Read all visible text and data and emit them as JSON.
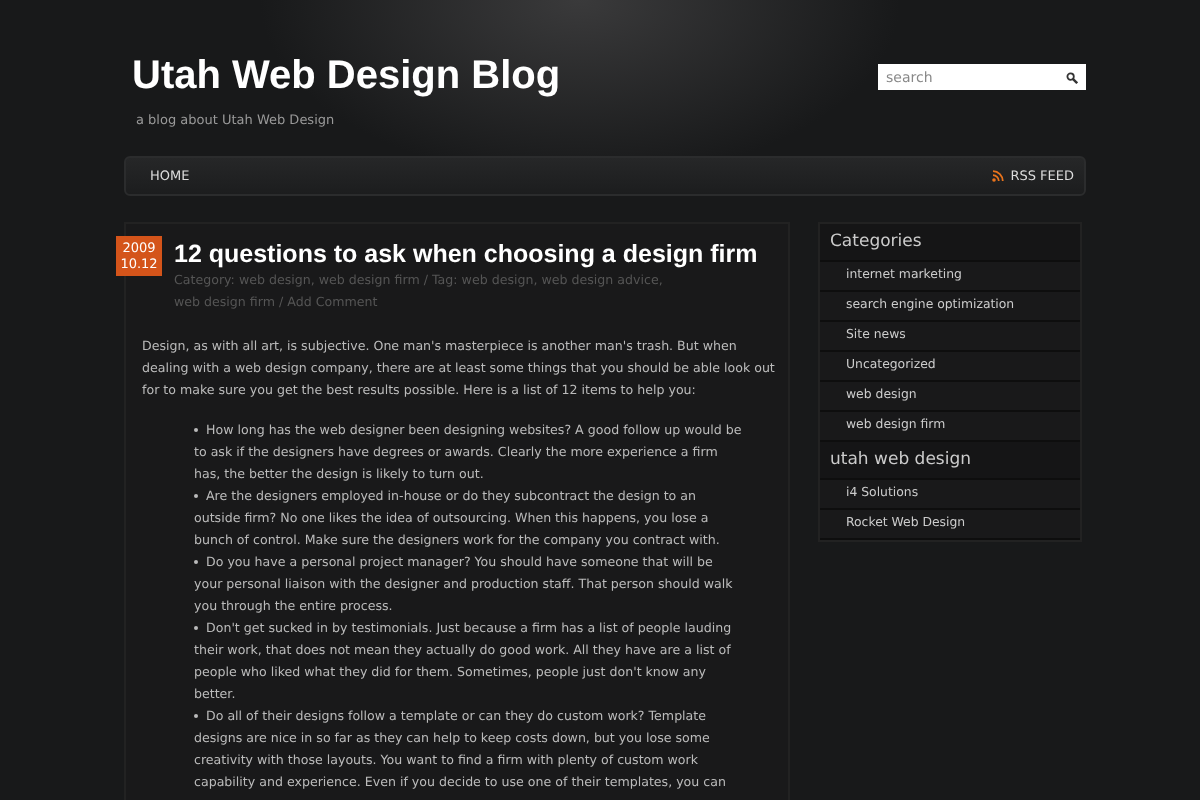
{
  "site": {
    "title": "Utah Web Design Blog",
    "tagline": "a blog about Utah Web Design"
  },
  "search": {
    "placeholder": "search"
  },
  "nav": {
    "items": [
      {
        "label": "HOME"
      }
    ],
    "feed": "RSS FEED"
  },
  "post": {
    "date_year": "2009",
    "date_day": "10.12",
    "title": "12 questions to ask when choosing a design firm",
    "meta": [
      {
        "kind": "text",
        "text": "Category: "
      },
      {
        "kind": "link",
        "text": "web design"
      },
      {
        "kind": "text",
        "text": ", "
      },
      {
        "kind": "link",
        "text": "web design firm"
      },
      {
        "kind": "text",
        "text": " / Tag: "
      },
      {
        "kind": "link",
        "text": "web design"
      },
      {
        "kind": "text",
        "text": ", "
      },
      {
        "kind": "link",
        "text": "web design advice"
      },
      {
        "kind": "text",
        "text": ", "
      },
      {
        "kind": "link",
        "text": "web design firm"
      },
      {
        "kind": "text",
        "text": " / "
      },
      {
        "kind": "link",
        "text": "Add Comment"
      }
    ],
    "intro": "Design, as with all art, is subjective. One man's masterpiece is another man's trash. But when dealing with a web design company, there are at least some things that you should be able look out for to make sure you get the best results possible. Here is a list of 12 items to help you:",
    "bullets": [
      "How long has the web designer been designing websites? A good follow up would be to ask if the designers have degrees or awards. Clearly the more experience a firm has, the better the design is likely to turn out.",
      "Are the designers employed in-house or do they subcontract the design to an outside firm? No one likes the idea of outsourcing. When this happens, you lose a bunch of control. Make sure the designers work for the company you contract with.",
      "Do you have a personal project manager? You should have someone that will be your personal liaison with the designer and production staff. That person should walk you through the entire process.",
      "Don't get sucked in by testimonials. Just because a firm has a list of people lauding their work, that does not mean they actually do good work. All they have are a list of people who liked what they did for them. Sometimes, people just don't know any better.",
      "Do all of their designs follow a template or can they do custom work? Template designs are nice in so far as they can help to keep costs down, but you lose some creativity with those layouts. You want to find a firm with plenty of custom work capability and experience. Even if you decide to use one of their templates, you can"
    ]
  },
  "sidebar": [
    {
      "heading": "Categories",
      "items": [
        "internet marketing",
        "search engine optimization",
        "Site news",
        "Uncategorized",
        "web design",
        "web design firm"
      ]
    },
    {
      "heading": "utah web design",
      "items": [
        "i4 Solutions",
        "Rocket Web Design"
      ]
    }
  ]
}
